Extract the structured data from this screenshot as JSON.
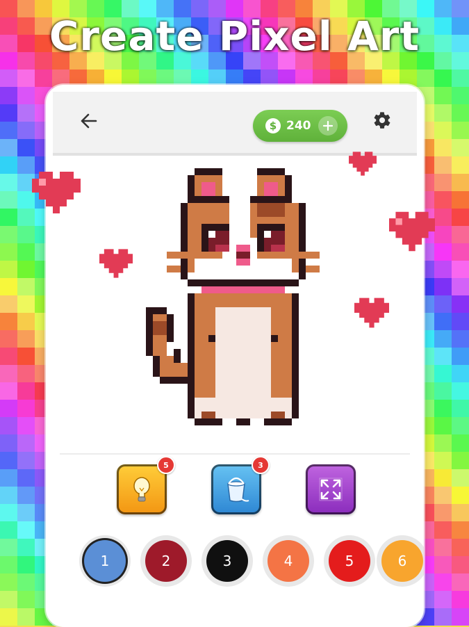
{
  "headline": "Create Pixel Art",
  "colors": {
    "coin_green": "#6cc046",
    "hearts": "#e23b55",
    "accent_red": "#e53935"
  },
  "topbar": {
    "back_icon": "arrow-left-icon",
    "coins": {
      "icon": "dollar-coin-icon",
      "symbol": "$",
      "amount": "240",
      "add_icon": "plus-icon"
    },
    "settings_icon": "gear-icon"
  },
  "artwork": {
    "subject": "pixel-cat",
    "decorations": "heart-icon"
  },
  "tools": [
    {
      "name": "hint",
      "icon": "lightbulb-icon",
      "badge": "5"
    },
    {
      "name": "bucket",
      "icon": "paint-bucket-icon",
      "badge": "3"
    },
    {
      "name": "fit",
      "icon": "expand-arrows-icon"
    }
  ],
  "palette": [
    {
      "number": "1",
      "color": "#5b8fd6",
      "selected": true
    },
    {
      "number": "2",
      "color": "#9e1a2a"
    },
    {
      "number": "3",
      "color": "#101010"
    },
    {
      "number": "4",
      "color": "#f47445"
    },
    {
      "number": "5",
      "color": "#e41c1c"
    },
    {
      "number": "6",
      "color": "#f8a52e"
    }
  ]
}
